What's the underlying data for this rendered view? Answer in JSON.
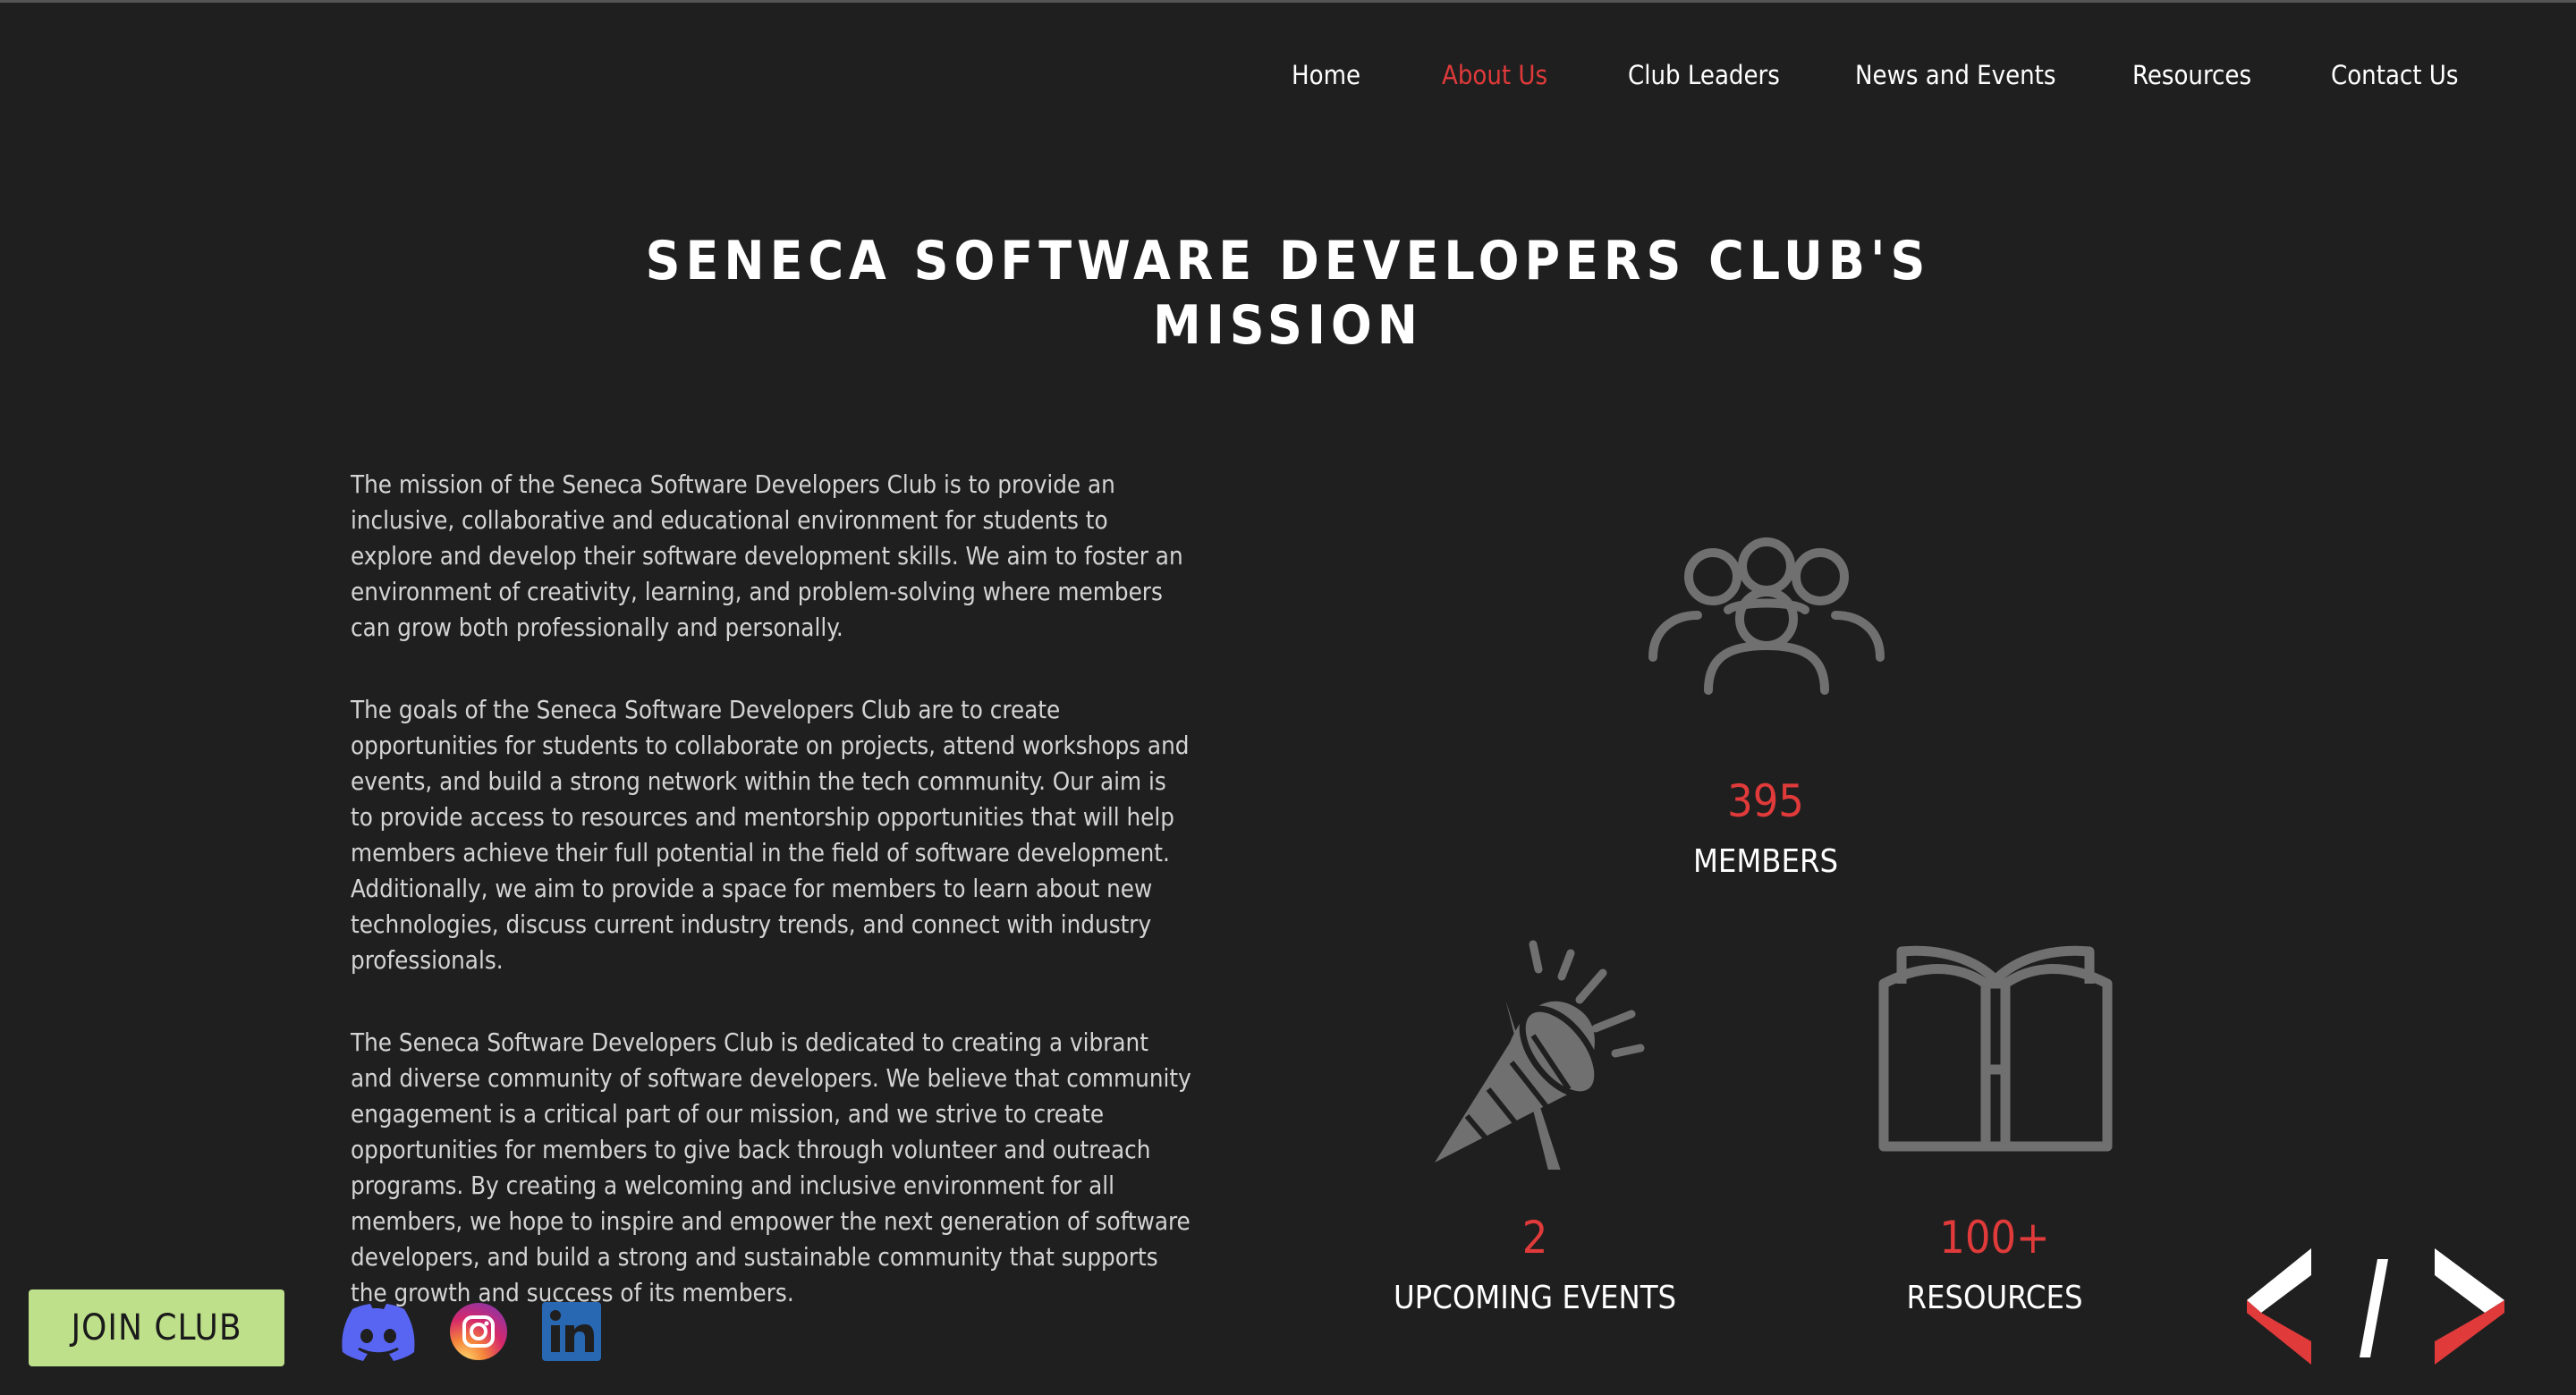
{
  "nav": {
    "items": [
      "Home",
      "About Us",
      "Club Leaders",
      "News and Events",
      "Resources",
      "Contact Us"
    ],
    "active": "About Us"
  },
  "page": {
    "title_line1": "SENECA SOFTWARE DEVELOPERS CLUB'S",
    "title_line2": "MISSION"
  },
  "mission": {
    "paragraphs": [
      "The mission of the Seneca Software Developers Club is to provide an inclusive, collaborative and educational environment for students to explore and develop their software development skills. We aim to foster an environment of creativity, learning, and problem-solving where members can grow both professionally and personally.",
      "The goals of the Seneca Software Developers Club are to create opportunities for students to collaborate on projects, attend workshops and events, and build a strong network within the tech community. Our aim is to provide access to resources and mentorship opportunities that will help members achieve their full potential in the field of software development. Additionally, we aim to provide a space for members to learn about new technologies, discuss current industry trends, and connect with industry professionals.",
      "The Seneca Software Developers Club is dedicated to creating a vibrant and diverse community of software developers. We believe that community engagement is a critical part of our mission, and we strive to create opportunities for members to give back through volunteer and outreach programs. By creating a welcoming and inclusive environment for all members, we hope to inspire and empower the next generation of software developers, and build a strong and sustainable community that supports the growth and success of its members."
    ]
  },
  "stats": {
    "members": {
      "value": "395",
      "label": "MEMBERS",
      "icon": "group-icon"
    },
    "events": {
      "value": "2",
      "label": "UPCOMING EVENTS",
      "icon": "party-popper-icon"
    },
    "resources": {
      "value": "100+",
      "label": "RESOURCES",
      "icon": "open-book-icon"
    }
  },
  "footer": {
    "join_label": "JOIN CLUB",
    "socials": [
      "discord-icon",
      "instagram-icon",
      "linkedin-icon"
    ]
  },
  "colors": {
    "background": "#1f1f1f",
    "accent_red": "#e03a3a",
    "join_green": "#bfe08a",
    "icon_gray": "#707070"
  }
}
